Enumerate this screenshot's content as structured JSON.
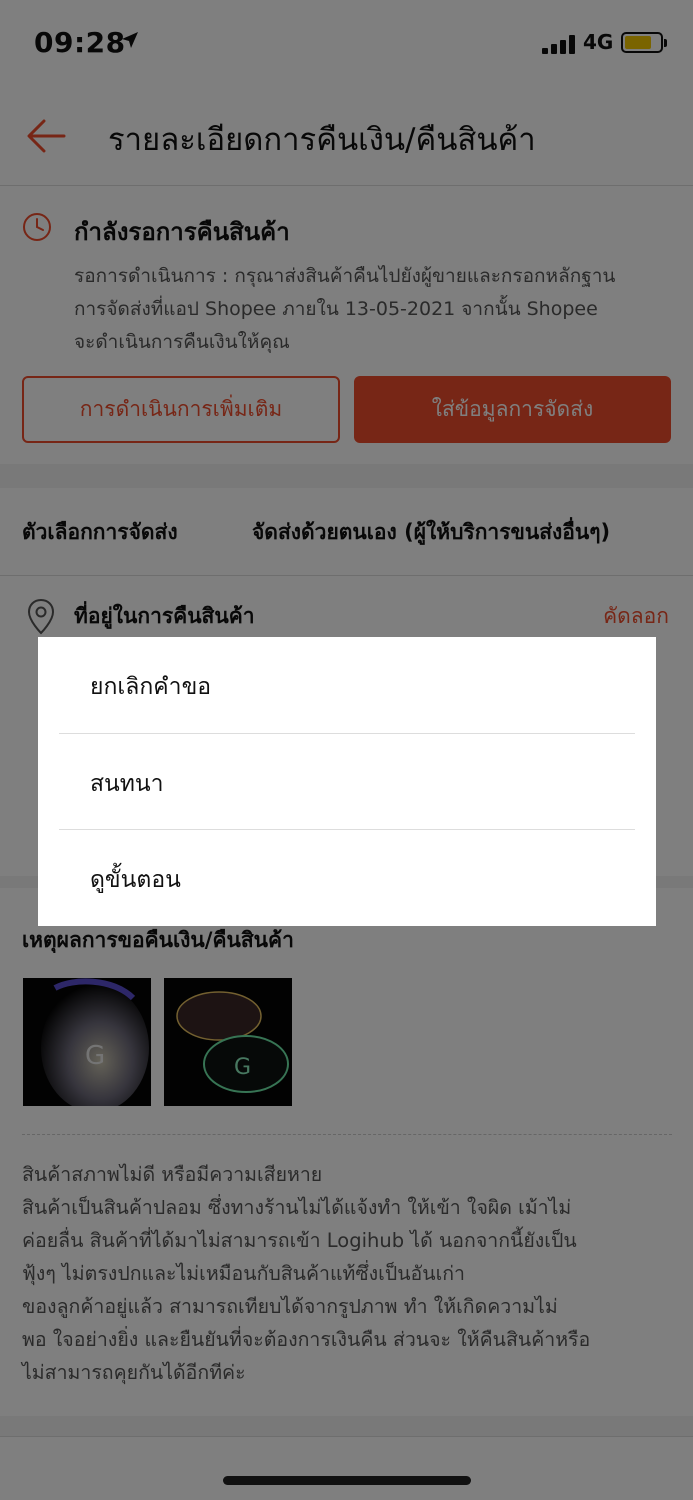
{
  "status_bar": {
    "time": "09:28",
    "network": "4G",
    "battery_color": "#f5c800"
  },
  "header": {
    "title": "รายละเอียดการคืนเงิน/คืนสินค้า",
    "back_icon": "arrow-left-icon"
  },
  "return_status": {
    "title": "กำลังรอการคืนสินค้า",
    "description_lines": [
      "รอการดำเนินการ : กรุณาส่งสินค้าคืนไปยังผู้ขายและกรอกหลักฐาน",
      "การจัดส่งที่แอป Shopee ภายใน 13-05-2021 จากนั้น Shopee",
      "จะดำเนินการคืนเงินให้คุณ"
    ],
    "more_actions_label": "การดำเนินการเพิ่มเติม",
    "enter_shipping_label": "ใส่ข้อมูลการจัดส่ง"
  },
  "shipping_option": {
    "label": "ตัวเลือกการจัดส่ง",
    "value": "จัดส่งด้วยตนเอง (ผู้ให้บริการขนส่งอื่นๆ)"
  },
  "return_address": {
    "label": "ที่อยู่ในการคืนสินค้า",
    "copy_label": "คัดลอก"
  },
  "reason": {
    "title": "เหตุผลการขอคืนเงิน/คืนสินค้า",
    "text_lines": [
      "สินค้าสภาพไม่ดี หรือมีความเสียหาย",
      "สินค้าเป็นสินค้าปลอม ซึ่งทางร้านไม่ได้แจ้งทำ ให้เข้า ใจผิด เม้าไม่",
      "ค่อยลื่น สินค้าที่ได้มาไม่สามารถเข้า Logihub ได้ นอกจากนี้ยังเป็น",
      "ฟุ้งๆ ไม่ตรงปกและไม่เหมือนกับสินค้าแท้ซึ่งเป็นอันเก่า",
      "ของลูกค้าอยู่แล้ว สามารถเทียบได้จากรูปภาพ ทำ ให้เกิดความไม่",
      "พอ ใจอย่างยิ่ง และยืนยันที่จะต้องการเงินคืน ส่วนจะ ให้คืนสินค้าหรือ",
      "ไม่สามารถคุยกันได้อีกทีค่ะ"
    ]
  },
  "popup_menu": {
    "items": [
      {
        "label": "ยกเลิกคำขอ"
      },
      {
        "label": "สนทนา"
      },
      {
        "label": "ดูขั้นตอน"
      }
    ]
  },
  "colors": {
    "accent": "#ee4d2d",
    "overlay": "rgba(0,0,0,0.5)"
  }
}
